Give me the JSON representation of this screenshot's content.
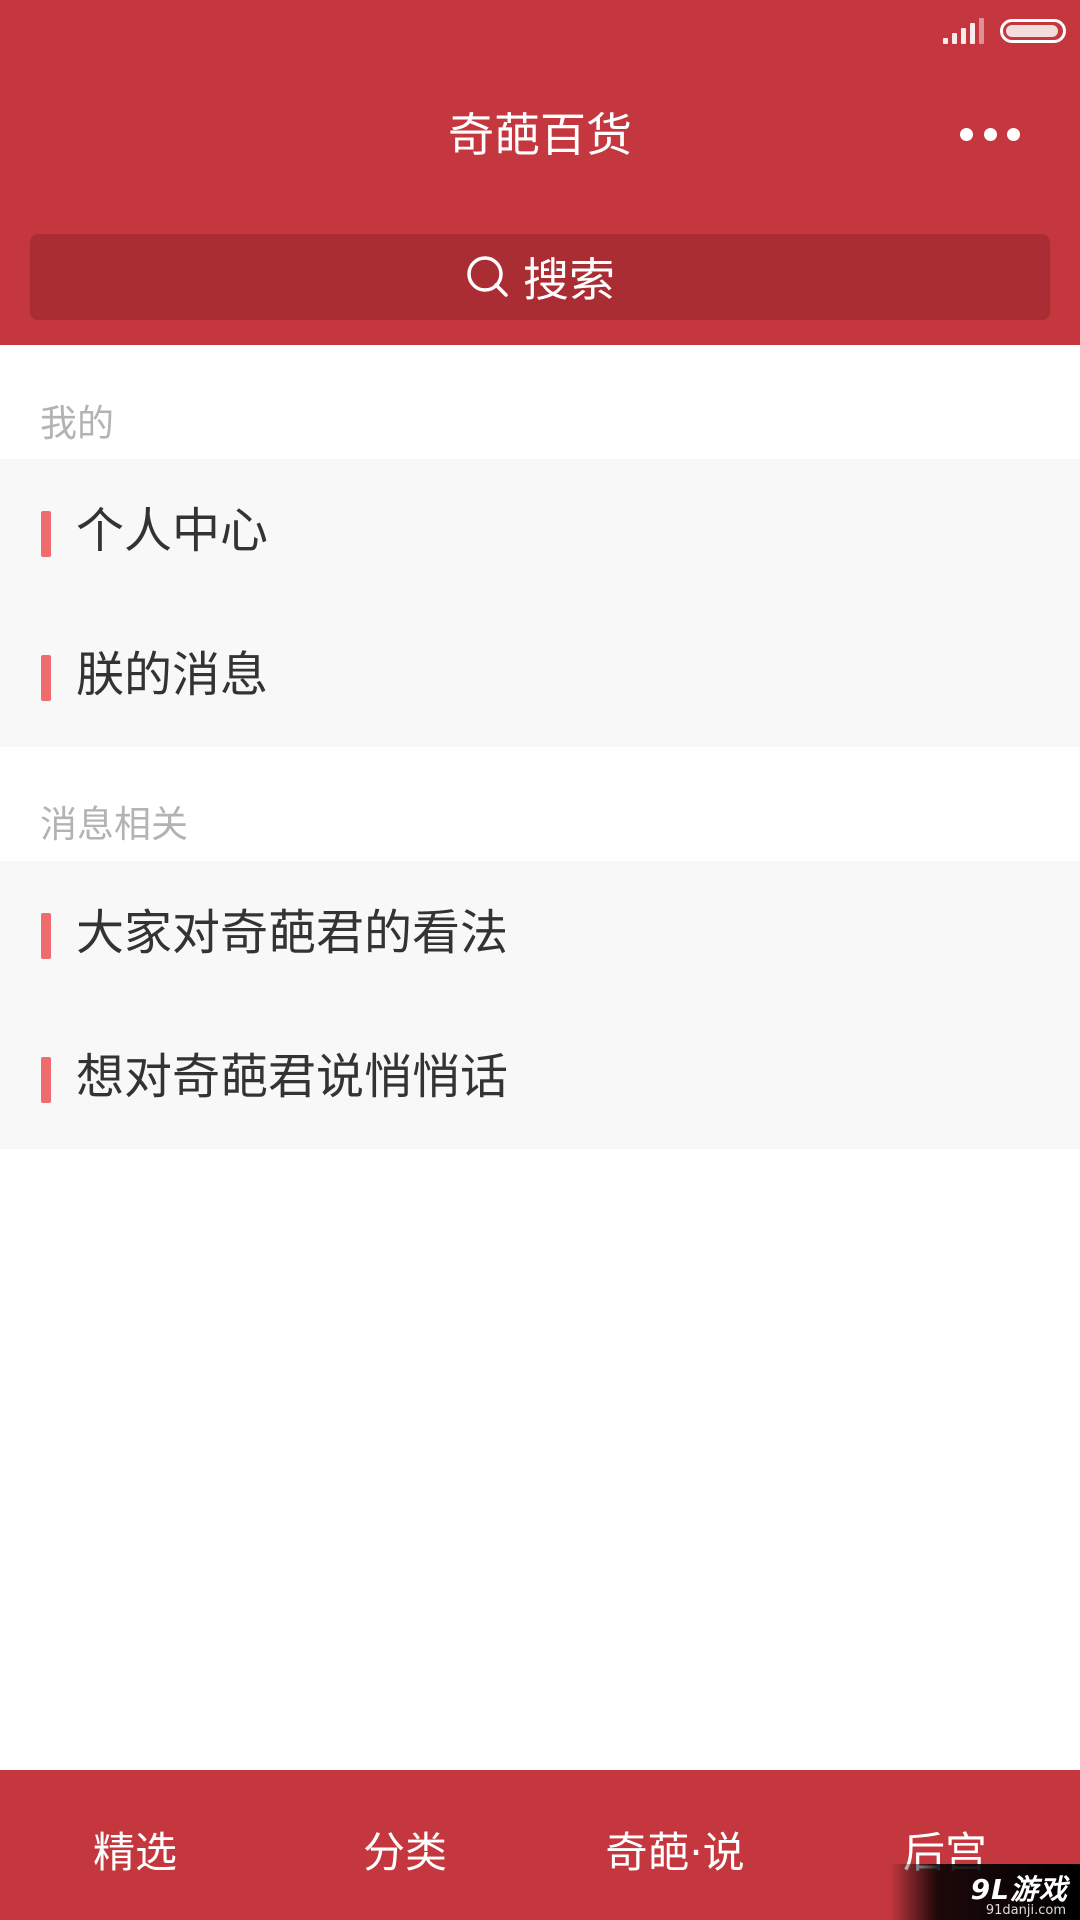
{
  "colors": {
    "header_bg": "#c4373e",
    "search_bg": "#a92d32",
    "accent_bar": "#ef6b6d",
    "list_bg": "#f8f8f8"
  },
  "status_bar": {
    "signal_icon": "signal-icon",
    "battery_icon": "battery-icon"
  },
  "header": {
    "title": "奇葩百货",
    "more_icon": "more-icon"
  },
  "search": {
    "label": "搜索",
    "icon": "search-icon"
  },
  "sections": [
    {
      "label": "我的",
      "items": [
        {
          "label": "个人中心"
        },
        {
          "label": "朕的消息"
        }
      ]
    },
    {
      "label": "消息相关",
      "items": [
        {
          "label": "大家对奇葩君的看法"
        },
        {
          "label": "想对奇葩君说悄悄话"
        }
      ]
    }
  ],
  "tabbar": {
    "tabs": [
      {
        "label": "精选"
      },
      {
        "label": "分类"
      },
      {
        "label": "奇葩·说"
      },
      {
        "label": "后宫"
      }
    ]
  },
  "watermark": {
    "main": "9L游戏",
    "sub": "91danji.com"
  }
}
